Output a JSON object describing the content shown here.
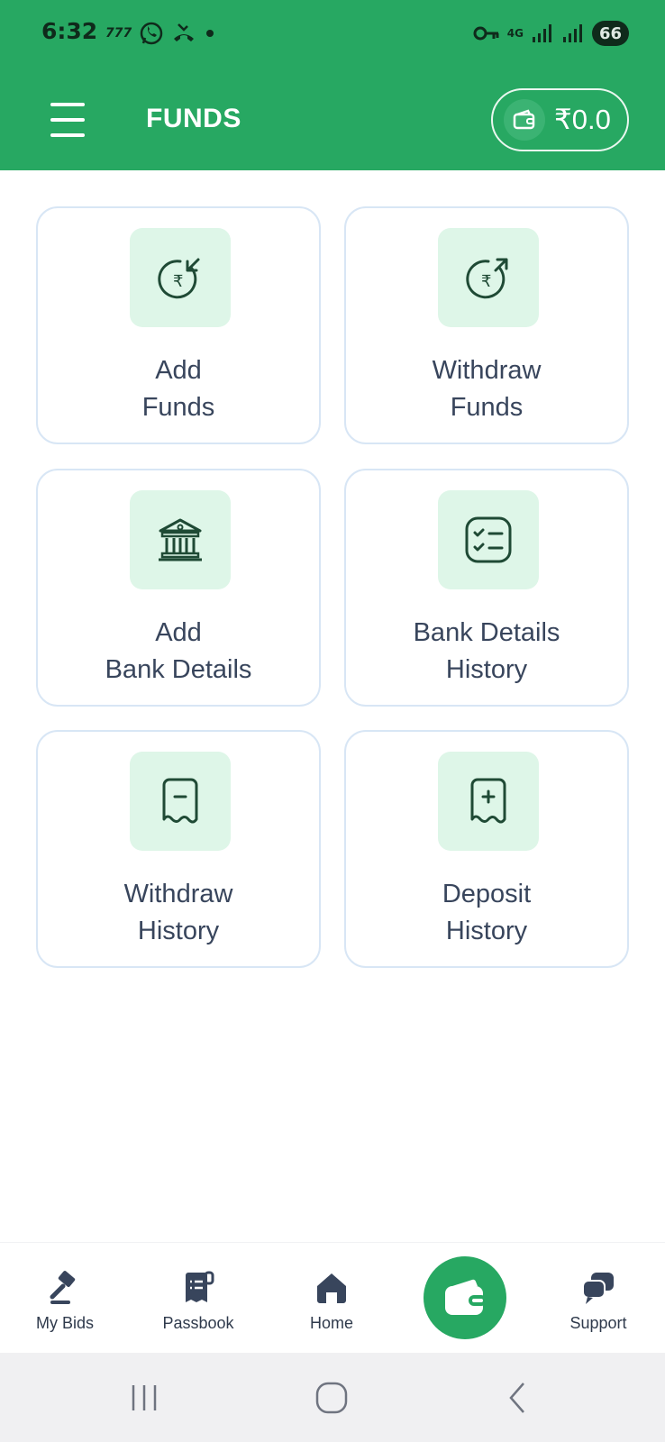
{
  "status_bar": {
    "time": "6:32",
    "left_icons": [
      "carrier-777-icon",
      "whatsapp-icon",
      "missed-call-icon",
      "dot-icon"
    ],
    "network": "4G",
    "battery": "66"
  },
  "header": {
    "title": "FUNDS",
    "wallet_balance": "₹0.0",
    "background_color": "#27a862"
  },
  "cards": [
    {
      "line1": "Add",
      "line2": "Funds",
      "icon": "rupee-deposit-icon"
    },
    {
      "line1": "Withdraw",
      "line2": "Funds",
      "icon": "rupee-withdraw-icon"
    },
    {
      "line1": "Add",
      "line2": "Bank Details",
      "icon": "bank-icon"
    },
    {
      "line1": "Bank Details",
      "line2": "History",
      "icon": "checklist-icon"
    },
    {
      "line1": "Withdraw",
      "line2": "History",
      "icon": "receipt-minus-icon"
    },
    {
      "line1": "Deposit",
      "line2": "History",
      "icon": "receipt-plus-icon"
    }
  ],
  "bottom_nav": {
    "items": [
      {
        "label": "My Bids",
        "icon": "gavel-icon"
      },
      {
        "label": "Passbook",
        "icon": "passbook-icon"
      },
      {
        "label": "Home",
        "icon": "home-icon"
      },
      {
        "label": "",
        "icon": "wallet-icon",
        "active": true
      },
      {
        "label": "Support",
        "icon": "chat-bubbles-icon"
      }
    ]
  },
  "system_nav": [
    "recent-apps-icon",
    "home-circle-icon",
    "back-icon"
  ],
  "colors": {
    "accent": "#27a862",
    "icon_tile": "#def6e8",
    "card_border": "#d8e6f5",
    "text": "#38455c"
  }
}
